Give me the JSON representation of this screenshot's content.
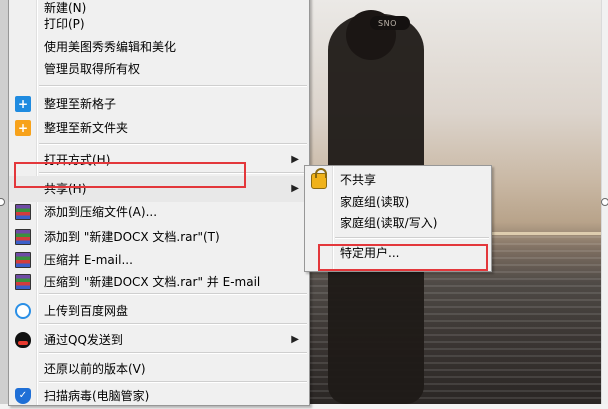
{
  "context_menu": {
    "items": [
      {
        "label": "新建(N)"
      },
      {
        "label": "打印(P)"
      },
      {
        "label": "使用美图秀秀编辑和美化"
      },
      {
        "label": "管理员取得所有权"
      },
      {
        "label": "整理至新格子",
        "icon": "plus-square-icon"
      },
      {
        "label": "整理至新文件夹",
        "icon": "plus-folder-icon"
      },
      {
        "label": "打开方式(H)",
        "submenu": true
      },
      {
        "label": "共享(H)",
        "submenu": true
      },
      {
        "label": "添加到压缩文件(A)...",
        "icon": "winrar-icon"
      },
      {
        "label": "添加到 \"新建DOCX 文档.rar\"(T)",
        "icon": "winrar-icon"
      },
      {
        "label": "压缩并 E-mail...",
        "icon": "winrar-icon"
      },
      {
        "label": "压缩到 \"新建DOCX 文档.rar\" 并 E-mail",
        "icon": "winrar-icon"
      },
      {
        "label": "上传到百度网盘",
        "icon": "baidu-cloud-icon"
      },
      {
        "label": "通过QQ发送到",
        "icon": "qq-penguin-icon",
        "submenu": true
      },
      {
        "label": "还原以前的版本(V)"
      },
      {
        "label": "扫描病毒(电脑管家)",
        "icon": "shield-icon"
      }
    ]
  },
  "share_submenu": {
    "items": [
      {
        "label": "不共享",
        "icon": "lock-icon"
      },
      {
        "label": "家庭组(读取)"
      },
      {
        "label": "家庭组(读取/写入)"
      },
      {
        "label": "特定用户..."
      }
    ]
  },
  "photo": {
    "cap_text": "SNO"
  },
  "colors": {
    "menu_bg": "#f0f0f0",
    "highlight_red": "#e3373b",
    "icon_blue": "#1f8be0",
    "icon_orange": "#f7a21b"
  }
}
